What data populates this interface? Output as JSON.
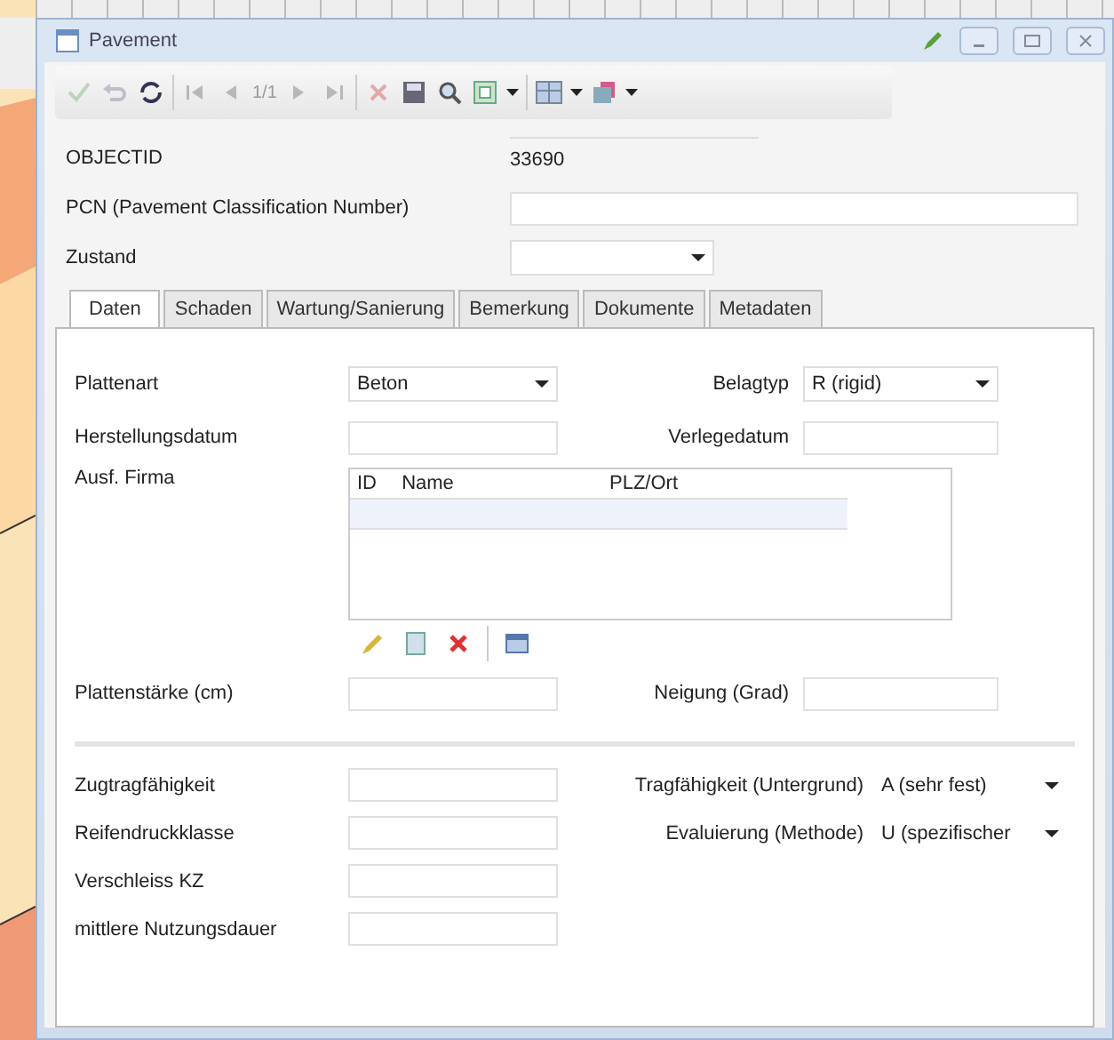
{
  "window": {
    "title": "Pavement"
  },
  "toolbar": [
    {
      "kind": "check",
      "disabled": true
    },
    {
      "kind": "undo",
      "disabled": true
    },
    {
      "kind": "refresh",
      "disabled": false
    },
    {
      "kind": "sep"
    },
    {
      "kind": "first",
      "disabled": true
    },
    {
      "kind": "prev",
      "disabled": true
    },
    {
      "kind": "page",
      "text": "1/1"
    },
    {
      "kind": "next",
      "disabled": true
    },
    {
      "kind": "last",
      "disabled": true
    },
    {
      "kind": "sep"
    },
    {
      "kind": "delete",
      "disabled": true
    },
    {
      "kind": "save",
      "disabled": false
    },
    {
      "kind": "search",
      "disabled": false
    },
    {
      "kind": "export",
      "disabled": false
    },
    {
      "kind": "caret"
    },
    {
      "kind": "sep"
    },
    {
      "kind": "layout",
      "disabled": false
    },
    {
      "kind": "caret"
    },
    {
      "kind": "box",
      "disabled": false
    },
    {
      "kind": "caret"
    }
  ],
  "header_fields": [
    {
      "kind": "readonly",
      "label": "OBJECTID",
      "value": "33690"
    },
    {
      "kind": "text",
      "label": "PCN (Pavement Classification Number)"
    },
    {
      "kind": "select",
      "label": "Zustand"
    }
  ],
  "tabs": [
    {
      "label": "Daten",
      "selected": true
    },
    {
      "label": "Schaden",
      "selected": false
    },
    {
      "label": "Wartung/Sanierung",
      "selected": false
    },
    {
      "label": "Bemerkung",
      "selected": false
    },
    {
      "label": "Dokumente",
      "selected": false
    },
    {
      "label": "Metadaten",
      "selected": false
    }
  ],
  "section1": [
    [
      {
        "label": "Plattenart",
        "kind": "select",
        "value": "Beton"
      },
      {
        "label": "Belagtyp",
        "kind": "select",
        "value": "R (rigid)"
      }
    ],
    [
      {
        "label": "Herstellungsdatum",
        "kind": "text"
      },
      {
        "label": "Verlegedatum",
        "kind": "text"
      }
    ]
  ],
  "firma": {
    "label": "Ausf. Firma",
    "columns": [
      "ID",
      "Name",
      "PLZ/Ort"
    ],
    "tools": [
      {
        "kind": "edit"
      },
      {
        "kind": "new"
      },
      {
        "kind": "delete"
      },
      {
        "kind": "sep"
      },
      {
        "kind": "window"
      }
    ]
  },
  "section2": [
    [
      {
        "label": "Plattenstärke (cm)",
        "kind": "text"
      },
      {
        "label": "Neigung (Grad)",
        "kind": "text"
      }
    ]
  ],
  "section3": [
    [
      {
        "label": "Zugtragfähigkeit",
        "kind": "text"
      },
      {
        "label": "Tragfähigkeit (Untergrund)",
        "kind": "select",
        "value": "A (sehr fest)"
      }
    ],
    [
      {
        "label": "Reifendruckklasse",
        "kind": "text"
      },
      {
        "label": "Evaluierung (Methode)",
        "kind": "select",
        "value": "U (spezifischer"
      }
    ],
    [
      {
        "label": "Verschleiss KZ",
        "kind": "text"
      }
    ],
    [
      {
        "label": "mittlere Nutzungsdauer",
        "kind": "text"
      }
    ]
  ]
}
